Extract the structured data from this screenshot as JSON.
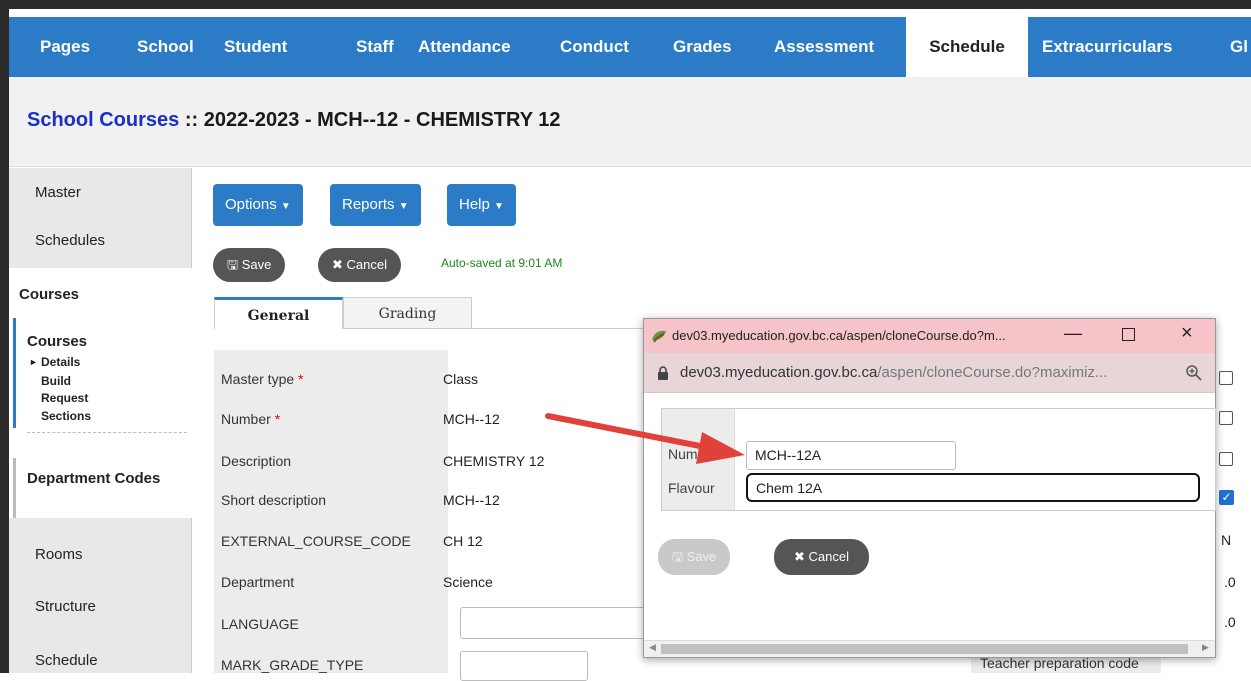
{
  "nav": {
    "tabs": [
      "Pages",
      "School",
      "Student",
      "Staff",
      "Attendance",
      "Conduct",
      "Grades",
      "Assessment",
      "Schedule",
      "Extracurriculars",
      "Gl"
    ],
    "active": "Schedule"
  },
  "title": {
    "link": "School Courses",
    "rest": " :: 2022-2023 - MCH--12 - CHEMISTRY 12"
  },
  "sidebar": {
    "master": "Master",
    "schedules": "Schedules",
    "courses_header": "Courses",
    "courses_group": "Courses",
    "sub": [
      "Details",
      "Build",
      "Request",
      "Sections"
    ],
    "department_codes": "Department Codes",
    "rooms": "Rooms",
    "structure": "Structure",
    "schedule": "Schedule"
  },
  "toolbar": {
    "options": "Options",
    "reports": "Reports",
    "help": "Help",
    "save": "Save",
    "cancel": "Cancel",
    "autosave": "Auto-saved at 9:01 AM"
  },
  "tabs": {
    "general": "General",
    "grading": "Grading"
  },
  "form": {
    "rows": [
      {
        "label": "Master type",
        "required": true,
        "value": "Class"
      },
      {
        "label": "Number",
        "required": true,
        "value": "MCH--12"
      },
      {
        "label": "Description",
        "required": false,
        "value": "CHEMISTRY 12"
      },
      {
        "label": "Short description",
        "required": false,
        "value": "MCH--12"
      },
      {
        "label": "EXTERNAL_COURSE_CODE",
        "required": false,
        "value": "CH 12"
      },
      {
        "label": "Department",
        "required": false,
        "value": "Science"
      },
      {
        "label": "LANGUAGE",
        "required": false,
        "value": ""
      },
      {
        "label": "MARK_GRADE_TYPE",
        "required": false,
        "value": ""
      }
    ],
    "right_fragments": [
      "N",
      ".0",
      ".0"
    ],
    "teacher_prep": "Teacher preparation code"
  },
  "popup": {
    "window_title": "dev03.myeducation.gov.bc.ca/aspen/cloneCourse.do?m...",
    "address_host": "dev03.myeducation.gov.bc.ca",
    "address_path": "/aspen/cloneCourse.do?maximiz...",
    "number_label": "Numb",
    "number_value": "MCH--12A",
    "flavour_label": "Flavour",
    "flavour_value": "Chem 12A",
    "save": "Save",
    "cancel": "Cancel"
  },
  "colors": {
    "nav_blue": "#2b7bc6",
    "title_link": "#1a2fc6",
    "popup_title_bg": "#f5c3c8",
    "arrow_red": "#e0413a",
    "autosave_green": "#1a8a1a"
  }
}
